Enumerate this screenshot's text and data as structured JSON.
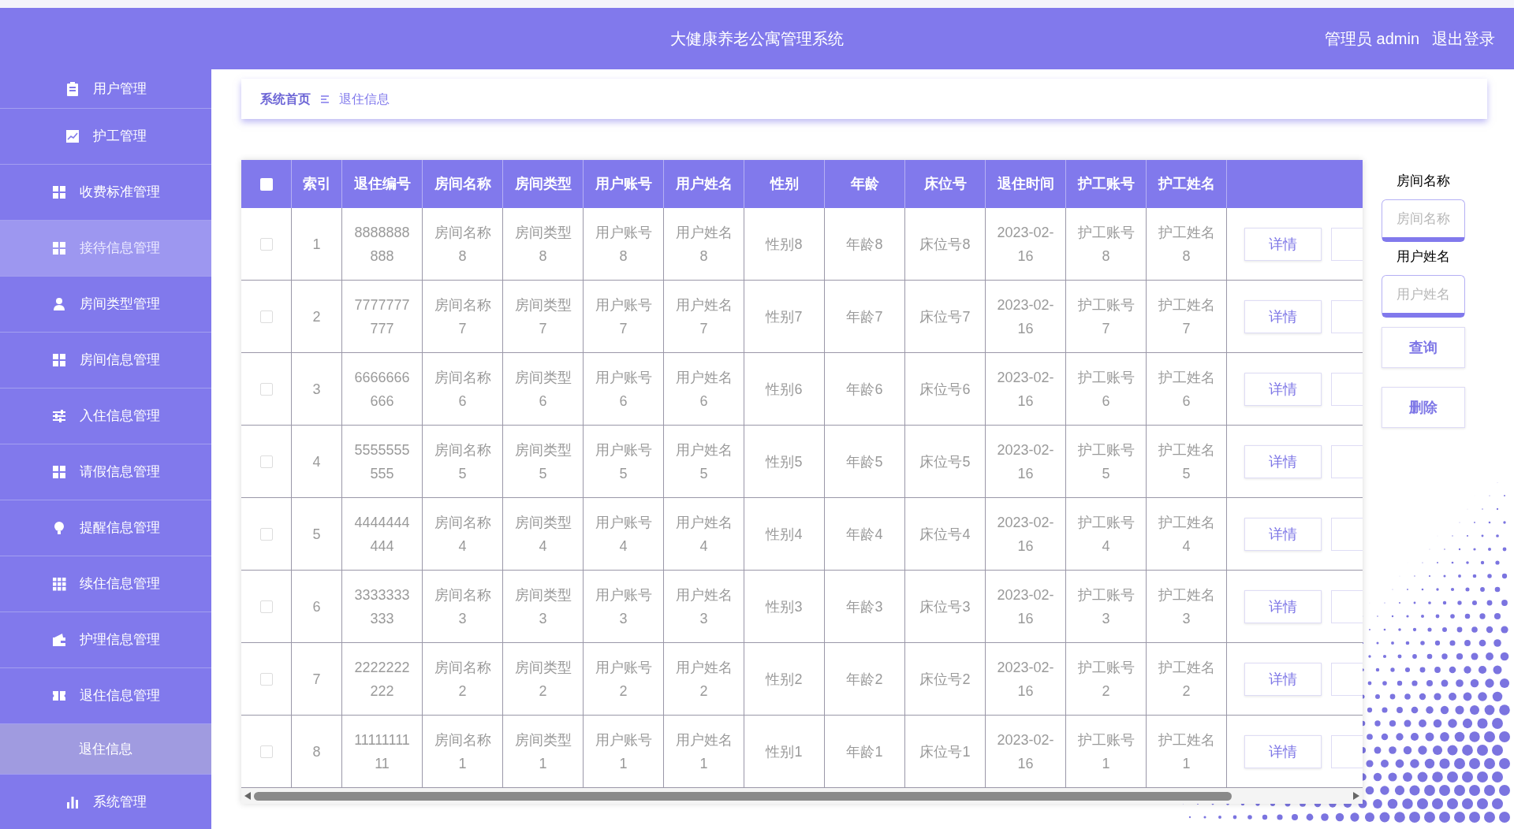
{
  "header": {
    "title": "大健康养老公寓管理系统",
    "user": "管理员 admin",
    "logout": "退出登录"
  },
  "sidebar": {
    "items": [
      {
        "label": "用户管理",
        "kind": "clipboard",
        "highlighted": false
      },
      {
        "label": "护工管理",
        "kind": "chart",
        "highlighted": false
      },
      {
        "label": "收费标准管理",
        "kind": "grid",
        "highlighted": false
      },
      {
        "label": "接待信息管理",
        "kind": "grid",
        "highlighted": true
      },
      {
        "label": "房间类型管理",
        "kind": "user",
        "highlighted": false
      },
      {
        "label": "房间信息管理",
        "kind": "grid",
        "highlighted": false
      },
      {
        "label": "入住信息管理",
        "kind": "sliders",
        "highlighted": false
      },
      {
        "label": "请假信息管理",
        "kind": "grid",
        "highlighted": false
      },
      {
        "label": "提醒信息管理",
        "kind": "bulb",
        "highlighted": false
      },
      {
        "label": "续住信息管理",
        "kind": "grid9",
        "highlighted": false
      },
      {
        "label": "护理信息管理",
        "kind": "wallet",
        "highlighted": false
      },
      {
        "label": "退住信息管理",
        "kind": "ticket",
        "highlighted": false,
        "children": [
          {
            "label": "退住信息",
            "selected": true
          }
        ]
      },
      {
        "label": "系统管理",
        "kind": "bars",
        "highlighted": false
      }
    ]
  },
  "breadcrumb": {
    "home": "系统首页",
    "current": "退住信息"
  },
  "table": {
    "select_all": {
      "checked": false
    },
    "columns": [
      "索引",
      "退住编号",
      "房间名称",
      "房间类型",
      "用户账号",
      "用户姓名",
      "性别",
      "年龄",
      "床位号",
      "退住时间",
      "护工账号",
      "护工姓名"
    ],
    "rows": [
      {
        "checked": false,
        "cells": [
          "1",
          "8888888888",
          "房间名称8",
          "房间类型8",
          "用户账号8",
          "用户姓名8",
          "性别8",
          "年龄8",
          "床位号8",
          "2023-02-16",
          "护工账号8",
          "护工姓名8"
        ],
        "action": "详情"
      },
      {
        "checked": false,
        "cells": [
          "2",
          "7777777777",
          "房间名称7",
          "房间类型7",
          "用户账号7",
          "用户姓名7",
          "性别7",
          "年龄7",
          "床位号7",
          "2023-02-16",
          "护工账号7",
          "护工姓名7"
        ],
        "action": "详情"
      },
      {
        "checked": false,
        "cells": [
          "3",
          "6666666666",
          "房间名称6",
          "房间类型6",
          "用户账号6",
          "用户姓名6",
          "性别6",
          "年龄6",
          "床位号6",
          "2023-02-16",
          "护工账号6",
          "护工姓名6"
        ],
        "action": "详情"
      },
      {
        "checked": false,
        "cells": [
          "4",
          "5555555555",
          "房间名称5",
          "房间类型5",
          "用户账号5",
          "用户姓名5",
          "性别5",
          "年龄5",
          "床位号5",
          "2023-02-16",
          "护工账号5",
          "护工姓名5"
        ],
        "action": "详情"
      },
      {
        "checked": false,
        "cells": [
          "5",
          "4444444444",
          "房间名称4",
          "房间类型4",
          "用户账号4",
          "用户姓名4",
          "性别4",
          "年龄4",
          "床位号4",
          "2023-02-16",
          "护工账号4",
          "护工姓名4"
        ],
        "action": "详情"
      },
      {
        "checked": false,
        "cells": [
          "6",
          "3333333333",
          "房间名称3",
          "房间类型3",
          "用户账号3",
          "用户姓名3",
          "性别3",
          "年龄3",
          "床位号3",
          "2023-02-16",
          "护工账号3",
          "护工姓名3"
        ],
        "action": "详情"
      },
      {
        "checked": false,
        "cells": [
          "7",
          "2222222222",
          "房间名称2",
          "房间类型2",
          "用户账号2",
          "用户姓名2",
          "性别2",
          "年龄2",
          "床位号2",
          "2023-02-16",
          "护工账号2",
          "护工姓名2"
        ],
        "action": "详情"
      },
      {
        "checked": false,
        "cells": [
          "8",
          "1111111111",
          "房间名称1",
          "房间类型1",
          "用户账号1",
          "用户姓名1",
          "性别1",
          "年龄1",
          "床位号1",
          "2023-02-16",
          "护工账号1",
          "护工姓名1"
        ],
        "action": "详情"
      }
    ]
  },
  "search": {
    "fields": [
      {
        "label": "房间名称",
        "placeholder": "房间名称"
      },
      {
        "label": "用户姓名",
        "placeholder": "用户姓名"
      }
    ],
    "buttons": [
      "查询",
      "删除"
    ]
  }
}
